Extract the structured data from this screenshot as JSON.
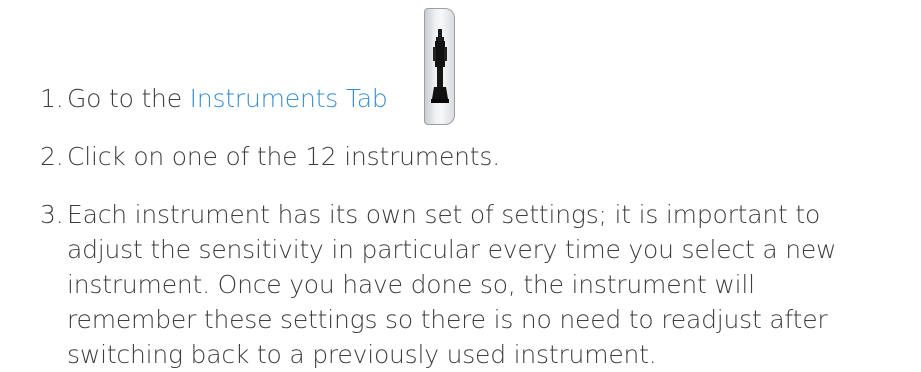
{
  "steps": [
    {
      "number": "1.",
      "before_link": "Go to the ",
      "link": "Instruments Tab",
      "after_link": "."
    },
    {
      "number": "2.",
      "text": "Click on one of the 12 instruments."
    },
    {
      "number": "3.",
      "lines": [
        "Each instrument has its own set of settings; it is important to",
        "adjust the sensitivity in particular every time you select a new",
        "instrument. Once you have done so, the instrument will",
        "remember these settings so there is no need to readjust after",
        "switching back to a previously used instrument."
      ]
    }
  ],
  "icons": {
    "instruments_tab": "trumpet-icon"
  },
  "colors": {
    "text": "#3d3d3d",
    "link": "#3a8fd0"
  }
}
